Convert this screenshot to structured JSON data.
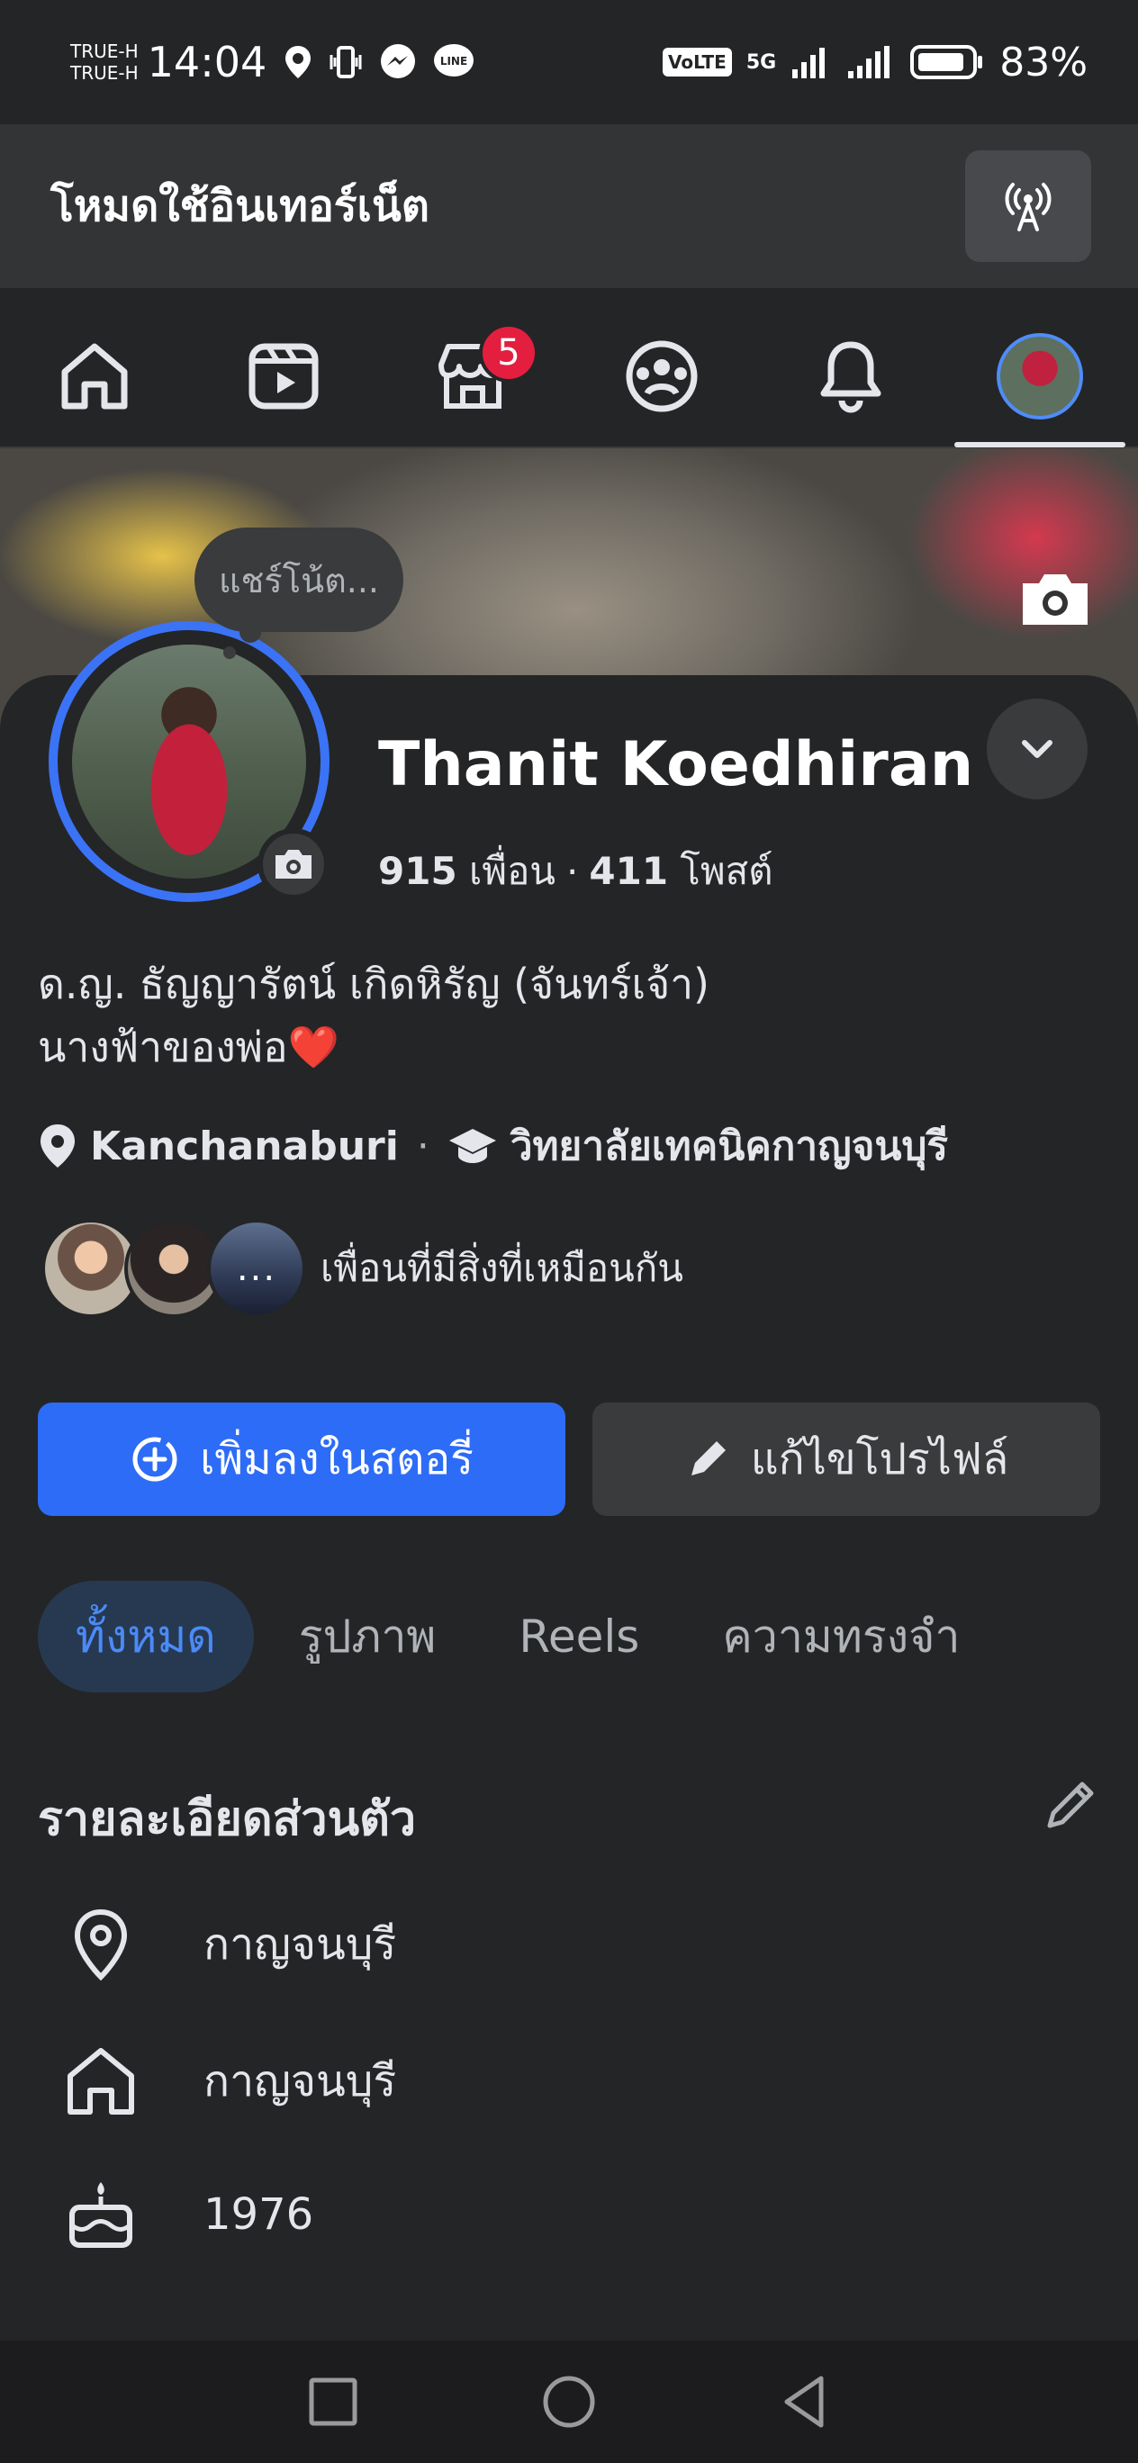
{
  "status_bar": {
    "carrier_1": "TRUE-H",
    "carrier_2": "TRUE-H",
    "time": "14:04",
    "network_label": "VoLTE",
    "network_gen": "5G",
    "battery": "83%"
  },
  "mode_bar": {
    "title": "โหมดใช้อินเทอร์เน็ต",
    "button_icon": "broadcast-icon"
  },
  "nav": {
    "tabs": [
      {
        "name": "home",
        "icon": "home-icon"
      },
      {
        "name": "video",
        "icon": "video-icon"
      },
      {
        "name": "marketplace",
        "icon": "store-icon",
        "badge": "5"
      },
      {
        "name": "groups",
        "icon": "groups-icon"
      },
      {
        "name": "notifications",
        "icon": "bell-icon"
      },
      {
        "name": "profile",
        "icon": "avatar"
      }
    ]
  },
  "note": {
    "placeholder": "แชร์โน้ต..."
  },
  "profile": {
    "name": "Thanit Koedhiran",
    "friends_count": "915",
    "friends_label": "เพื่อน",
    "posts_count": "411",
    "posts_label": "โพสต์",
    "bio_line1": "ด.ญ. ธัญญารัตน์ เกิดหิรัญ (จันทร์เจ้า)",
    "bio_line2": "นางฟ้าของพ่อ",
    "bio_emoji": "❤️",
    "location": "Kanchanaburi",
    "education": "วิทยาลัยเทคนิคกาญจนบุรี",
    "mutual_text": "เพื่อนที่มีสิ่งที่เหมือนกัน",
    "mutual_more": "..."
  },
  "actions": {
    "add_story": "เพิ่มลงในสตอรี่",
    "edit_profile": "แก้ไขโปรไฟล์"
  },
  "tabs": [
    {
      "label": "ทั้งหมด",
      "active": true
    },
    {
      "label": "รูปภาพ",
      "active": false
    },
    {
      "label": "Reels",
      "active": false
    },
    {
      "label": "ความทรงจำ",
      "active": false
    }
  ],
  "details": {
    "title": "รายละเอียดส่วนตัว",
    "items": [
      {
        "icon": "location-pin-icon",
        "text": "กาญจนบุรี"
      },
      {
        "icon": "home-icon",
        "text": "กาญจนบุรี"
      },
      {
        "icon": "birthday-cake-icon",
        "text": "1976"
      }
    ]
  },
  "colors": {
    "background": "#242527",
    "primary": "#2d6cf6",
    "badge": "#e41e3f",
    "active_tab_bg": "#263951",
    "active_tab_text": "#4b8af7"
  }
}
